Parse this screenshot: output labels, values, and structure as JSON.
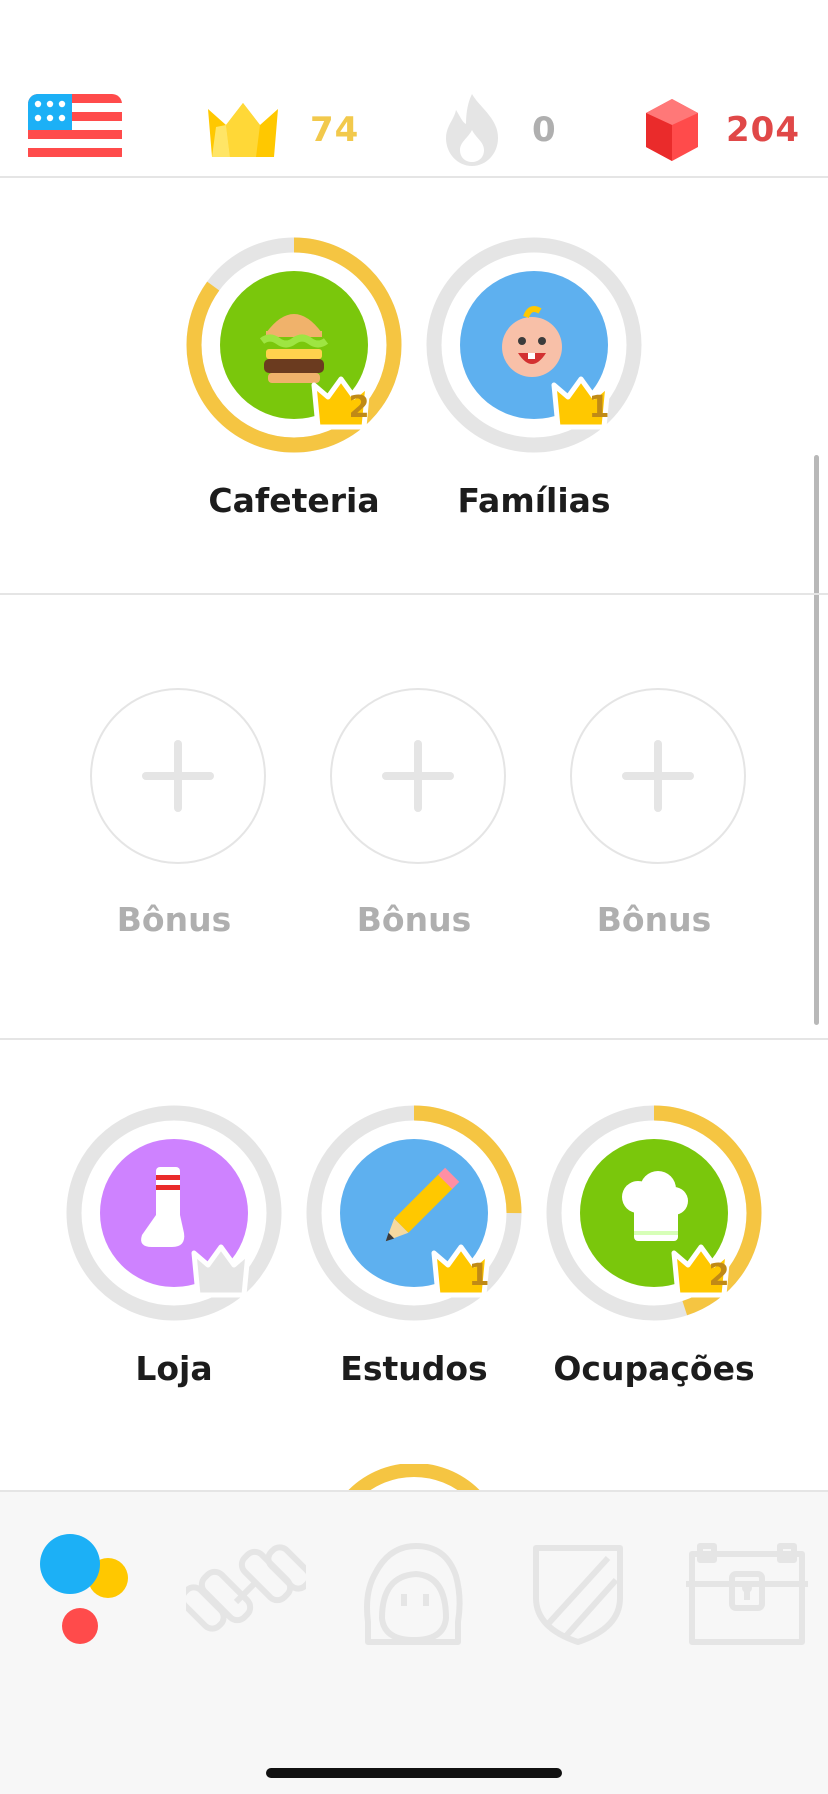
{
  "stats": {
    "language_flag": "us-flag-icon",
    "crowns": "74",
    "streak": "0",
    "gems": "204"
  },
  "colors": {
    "crown_gold": "#ffc800",
    "gem_red": "#ff4b4b",
    "progress_gold": "#f5c542",
    "ring_grey": "#e5e5e5",
    "green": "#7ac70c",
    "blue": "#5eb0ef",
    "purple": "#ce82ff"
  },
  "sections": {
    "row1": [
      {
        "label": "Cafeteria",
        "icon": "burger-icon",
        "level": "2",
        "progress": 0.85
      },
      {
        "label": "Famílias",
        "icon": "baby-icon",
        "level": "1",
        "progress": 0
      }
    ],
    "bonus": [
      {
        "label": "Bônus",
        "icon": "plus-icon"
      },
      {
        "label": "Bônus",
        "icon": "plus-icon"
      },
      {
        "label": "Bônus",
        "icon": "plus-icon"
      }
    ],
    "row3": [
      {
        "label": "Loja",
        "icon": "sock-icon",
        "level": "",
        "progress": 0
      },
      {
        "label": "Estudos",
        "icon": "pencil-icon",
        "level": "1",
        "progress": 0.25
      },
      {
        "label": "Ocupações",
        "icon": "chef-hat-icon",
        "level": "2",
        "progress": 0.45
      }
    ]
  },
  "tabs": [
    {
      "name": "learn",
      "icon": "learn-dots-icon",
      "active": true
    },
    {
      "name": "practice",
      "icon": "dumbbell-icon",
      "active": false
    },
    {
      "name": "profile",
      "icon": "profile-icon",
      "active": false
    },
    {
      "name": "leagues",
      "icon": "shield-icon",
      "active": false
    },
    {
      "name": "shop",
      "icon": "treasure-chest-icon",
      "active": false
    }
  ]
}
